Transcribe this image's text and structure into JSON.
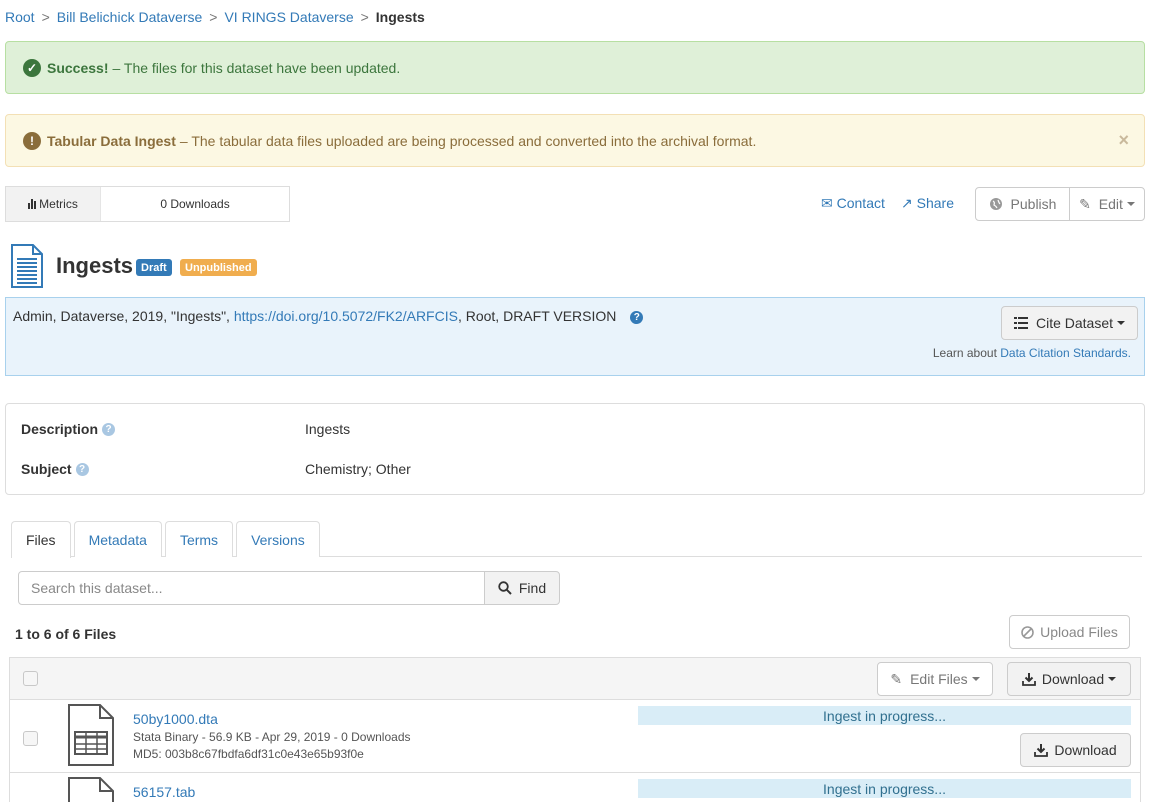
{
  "breadcrumb": {
    "items": [
      "Root",
      "Bill Belichick Dataverse",
      "VI RINGS Dataverse"
    ],
    "separator": ">",
    "current": "Ingests"
  },
  "alerts": {
    "success": {
      "title": "Success!",
      "text": "– The files for this dataset have been updated.",
      "icon": "check-circle-icon"
    },
    "warning": {
      "title": "Tabular Data Ingest",
      "text": "– The tabular data files uploaded are being processed and converted into the archival format.",
      "icon": "exclamation-circle-icon",
      "close": "×"
    }
  },
  "metrics": {
    "label": "Metrics",
    "downloads": "0 Downloads"
  },
  "actions": {
    "contact": "Contact",
    "share": "Share",
    "publish": "Publish",
    "edit": "Edit"
  },
  "dataset": {
    "title": "Ingests",
    "badges": {
      "draft": "Draft",
      "unpublished": "Unpublished"
    }
  },
  "citation": {
    "prefix": "Admin, Dataverse, 2019, \"Ingests\", ",
    "doi": "https://doi.org/10.5072/FK2/ARFCIS",
    "suffix": ", Root, DRAFT VERSION",
    "help": "?",
    "cite_button": "Cite Dataset",
    "learn_prefix": "Learn about ",
    "learn_link": "Data Citation Standards."
  },
  "metadata": {
    "description_label": "Description",
    "description_value": "Ingests",
    "subject_label": "Subject",
    "subject_value": "Chemistry; Other"
  },
  "tabs": [
    "Files",
    "Metadata",
    "Terms",
    "Versions"
  ],
  "search": {
    "placeholder": "Search this dataset...",
    "button": "Find"
  },
  "files": {
    "count_label": "1 to 6 of 6 Files",
    "upload_button": "Upload Files",
    "edit_files_button": "Edit Files",
    "download_button": "Download",
    "rows": [
      {
        "name": "50by1000.dta",
        "info": "Stata Binary - 56.9 KB - Apr 29, 2019 - 0 Downloads",
        "md5": "MD5: 003b8c67fbdfa6df31c0e43e65b93f0e",
        "status": "Ingest in progress...",
        "download": "Download"
      },
      {
        "name": "56157.tab",
        "status": "Ingest in progress..."
      }
    ]
  },
  "colors": {
    "link": "#337ab7",
    "success_bg": "#dff0d8",
    "warning_bg": "#fcf8e3",
    "citation_bg": "#e9f3fb",
    "draft": "#337ab7",
    "unpublished": "#f0ad4e",
    "ingest_bg": "#d9edf7"
  }
}
